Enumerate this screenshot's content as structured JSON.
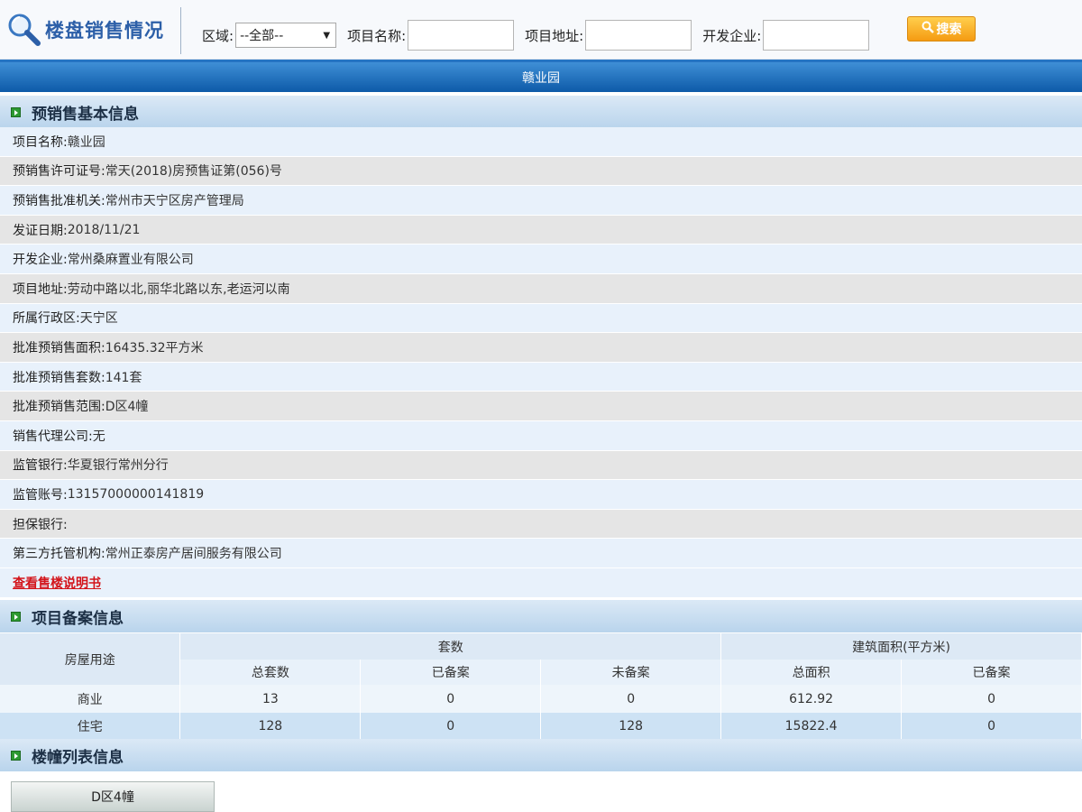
{
  "header": {
    "title": "楼盘销售情况",
    "filters": {
      "region_label": "区域:",
      "region_value": "--全部--",
      "project_name_label": "项目名称:",
      "project_name_value": "",
      "project_address_label": "项目地址:",
      "project_address_value": "",
      "developer_label": "开发企业:",
      "developer_value": ""
    },
    "search_button": "搜索",
    "search_icon": "magnifier-icon"
  },
  "project_title": "赣业园",
  "presale_section": {
    "title": "预销售基本信息",
    "rows": [
      {
        "label": "项目名称:",
        "value": "赣业园"
      },
      {
        "label": "预销售许可证号:",
        "value": "常天(2018)房预售证第(056)号"
      },
      {
        "label": "预销售批准机关:",
        "value": "常州市天宁区房产管理局"
      },
      {
        "label": "发证日期:",
        "value": "2018/11/21"
      },
      {
        "label": "开发企业:",
        "value": "常州桑麻置业有限公司"
      },
      {
        "label": "项目地址:",
        "value": "劳动中路以北,丽华北路以东,老运河以南"
      },
      {
        "label": "所属行政区:",
        "value": "天宁区"
      },
      {
        "label": "批准预销售面积:",
        "value": "16435.32平方米"
      },
      {
        "label": "批准预销售套数:",
        "value": "141套"
      },
      {
        "label": "批准预销售范围:",
        "value": "D区4幢"
      },
      {
        "label": "销售代理公司:",
        "value": "无"
      },
      {
        "label": "监管银行:",
        "value": "华夏银行常州分行"
      },
      {
        "label": "监管账号:",
        "value": "13157000000141819"
      },
      {
        "label": "担保银行:",
        "value": ""
      },
      {
        "label": "第三方托管机构:",
        "value": "常州正泰房产居间服务有限公司"
      }
    ],
    "link": "查看售楼说明书"
  },
  "record_section": {
    "title": "项目备案信息",
    "usage_header": "房屋用途",
    "group_units": "套数",
    "group_area": "建筑面积(平方米)",
    "sub_headers": [
      "总套数",
      "已备案",
      "未备案",
      "总面积",
      "已备案"
    ],
    "rows": [
      {
        "usage": "商业",
        "cells": [
          "13",
          "0",
          "0",
          "612.92",
          "0"
        ]
      },
      {
        "usage": "住宅",
        "cells": [
          "128",
          "0",
          "128",
          "15822.4",
          "0"
        ]
      }
    ]
  },
  "building_section": {
    "title": "楼幢列表信息",
    "buildings": [
      "D区4幢"
    ]
  },
  "colors": {
    "brand_blue": "#2c5fa8",
    "title_bar": "#1a6bbd",
    "link_red": "#d3141a",
    "search_orange": "#f59b12"
  }
}
